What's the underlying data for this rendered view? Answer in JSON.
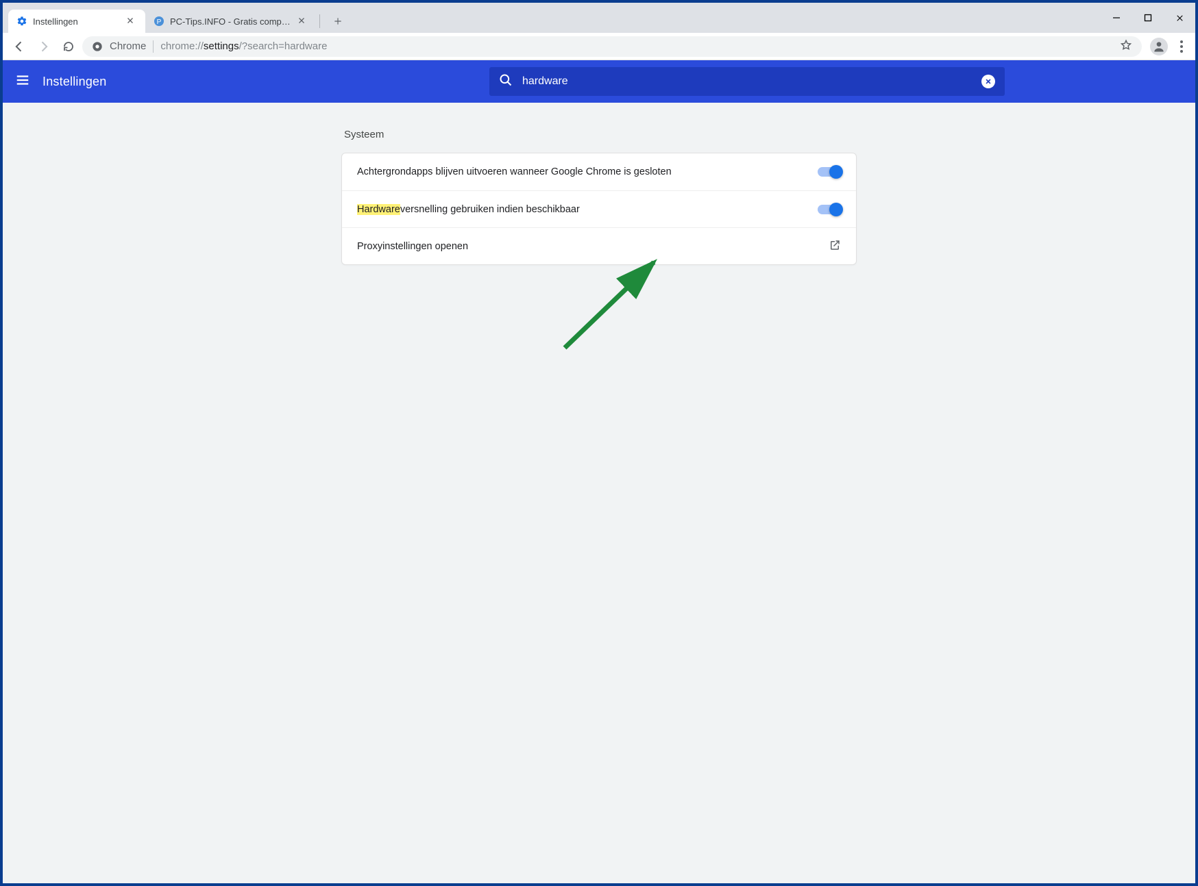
{
  "browser": {
    "tabs": [
      {
        "title": "Instellingen",
        "active": true
      },
      {
        "title": "PC-Tips.INFO - Gratis computer t",
        "active": false
      }
    ],
    "omnibox": {
      "brand": "Chrome",
      "url_scheme": "chrome://",
      "url_bold": "settings",
      "url_tail": "/?search=hardware"
    }
  },
  "settings": {
    "appbar_title": "Instellingen",
    "search_value": "hardware",
    "section_title": "Systeem",
    "rows": {
      "bg_apps": "Achtergrondapps blijven uitvoeren wanneer Google Chrome is gesloten",
      "hwaccel_hl": "Hardware",
      "hwaccel_rest": "versnelling gebruiken indien beschikbaar",
      "proxy": "Proxyinstellingen openen"
    }
  }
}
